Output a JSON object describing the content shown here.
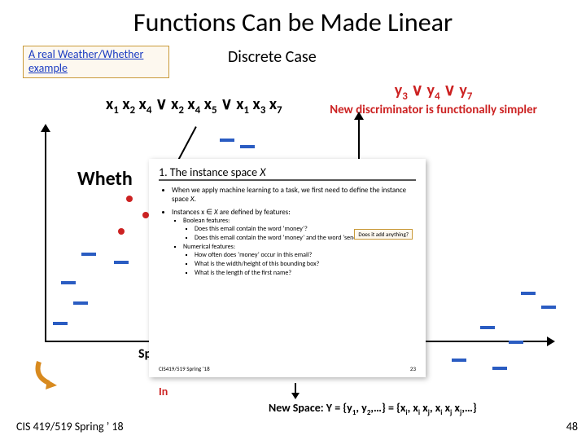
{
  "title": "Functions Can be Made Linear",
  "link_label": "A real Weather/Whether example",
  "subtitle": "Discrete Case",
  "formula_left_html": "x<sub>1</sub> x<sub>2</sub> x<sub>4</sub> <span class='or'>∨</span> x<sub>2</sub> x<sub>4</sub> x<sub>5</sub> <span class='or'>∨</span> x<sub>1</sub> x<sub>3</sub> x<sub>7</sub>",
  "formula_right_html": "y<sub>3</sub> <span class='or'>∨</span> y<sub>4</sub> <span class='or'>∨</span> y<sub>7</sub>",
  "discriminator_line": "New discriminator is functionally simpler",
  "whether": "Wheth",
  "sp": "Sp",
  "in": "In",
  "newspace_html": "New Space: Y = {y<sub>1</sub>, y<sub>2</sub>,…} = {x<sub>i</sub>, x<sub>i</sub> x<sub>j</sub>, x<sub>i</sub> x<sub>j</sub> x<sub>j</sub>,…}",
  "footer_left": "CIS 419/519 Spring ’ 18",
  "footer_right": "48",
  "inset": {
    "title_html": "1. The instance space <i>X</i>",
    "b1_html": "When we apply machine learning to a task, we first need to define the instance space <i>X</i>.",
    "b2_html": "Instances x ∈ <i>X</i> are defined by features:",
    "bool_hdr": "Boolean features:",
    "bool1": "Does this email contain the word ‘money’?",
    "bool2": "Does this email contain the word ‘money’ and the word ‘send’",
    "num_hdr": "Numerical features:",
    "num1": "How often does ‘money’ occur in this email?",
    "num2": "What is the width/height of this bounding box?",
    "num3": "What is the length of the first name?",
    "callout": "Does it add anything?",
    "fl": "CIS419/519 Spring ’18",
    "fr": "23"
  }
}
